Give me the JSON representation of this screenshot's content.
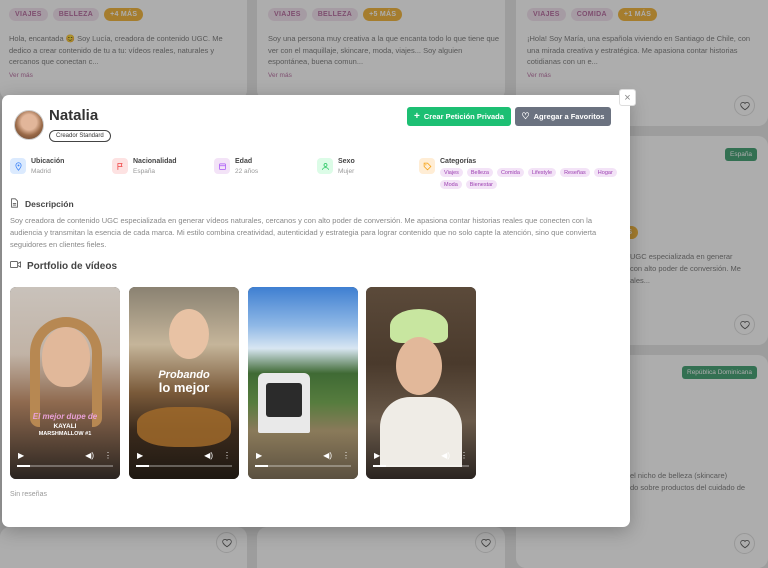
{
  "background": {
    "cards": [
      {
        "tags": [
          "VIAJES",
          "BELLEZA"
        ],
        "more": "+4 MÁS",
        "desc": "Hola, encantada 😊 Soy Lucía, creadora de contenido UGC. Me dedico a crear contenido de tu a tu: vídeos reales, naturales y cercanos que conectan c...",
        "link": "Ver más"
      },
      {
        "tags": [
          "VIAJES",
          "BELLEZA"
        ],
        "more": "+5 MÁS",
        "desc": "Soy una persona muy creativa a la que encanta todo lo que tiene que ver con el maquillaje, skincare, moda, viajes... Soy alguien espontánea, buena comun...",
        "link": "Ver más"
      },
      {
        "tags": [
          "VIAJES",
          "COMIDA"
        ],
        "more": "+1 MÁS",
        "desc": "¡Hola! Soy María, una española viviendo en Santiago de Chile, con una mirada creativa y estratégica. Me apasiona contar historias cotidianas con un e...",
        "link": "Ver más"
      }
    ],
    "right_card_2": {
      "country": "España",
      "more_partial": "ÁS",
      "lines": [
        "UGC especializada en generar",
        "con alto poder de conversión. Me",
        "ales..."
      ]
    },
    "right_card_3": {
      "country": "República Dominicana",
      "lines": [
        "el nicho de belleza (skincare)",
        "do sobre productos del cuidado de"
      ]
    }
  },
  "modal": {
    "close": "×",
    "name": "Natalia",
    "plan": "Creador Standard",
    "btn_request": "Crear Petición Privada",
    "btn_request_icon": "+",
    "btn_fav": "Agregar a Favoritos",
    "btn_fav_icon": "♡",
    "info": {
      "location": {
        "label": "Ubicación",
        "value": "Madrid"
      },
      "nationality": {
        "label": "Nacionalidad",
        "value": "España"
      },
      "age": {
        "label": "Edad",
        "value": "22 años"
      },
      "sex": {
        "label": "Sexo",
        "value": "Mujer"
      },
      "categories": {
        "label": "Categorías",
        "items": [
          "Viajes",
          "Belleza",
          "Comida",
          "Lifestyle",
          "Reseñas",
          "Hogar",
          "Moda",
          "Bienestar"
        ]
      }
    },
    "description_title": "Descripción",
    "description": "Soy creadora de contenido UGC especializada en generar vídeos naturales, cercanos y con alto poder de conversión. Me apasiona contar historias reales que conecten con la audiencia y transmitan la esencia de cada marca. Mi estilo combina creatividad, autenticidad y estrategia para lograr contenido que no solo capte la atención, sino que convierta seguidores en clientes fieles.",
    "portfolio_title": "Portfolio de vídeos",
    "videos": [
      {
        "caption_line1": "El mejor dupe de",
        "caption_line2": "KAYALI",
        "caption_line3": "MARSHMALLOW #1"
      },
      {
        "caption_line1": "Probando",
        "caption_line2": "lo mejor"
      },
      {},
      {}
    ],
    "no_reviews": "Sin reseñas"
  },
  "colors": {
    "primary_green": "#1dbf73",
    "secondary_gray": "#6b7280",
    "tag_pink": "#b4669c",
    "category_purple": "#9b3eb0"
  }
}
